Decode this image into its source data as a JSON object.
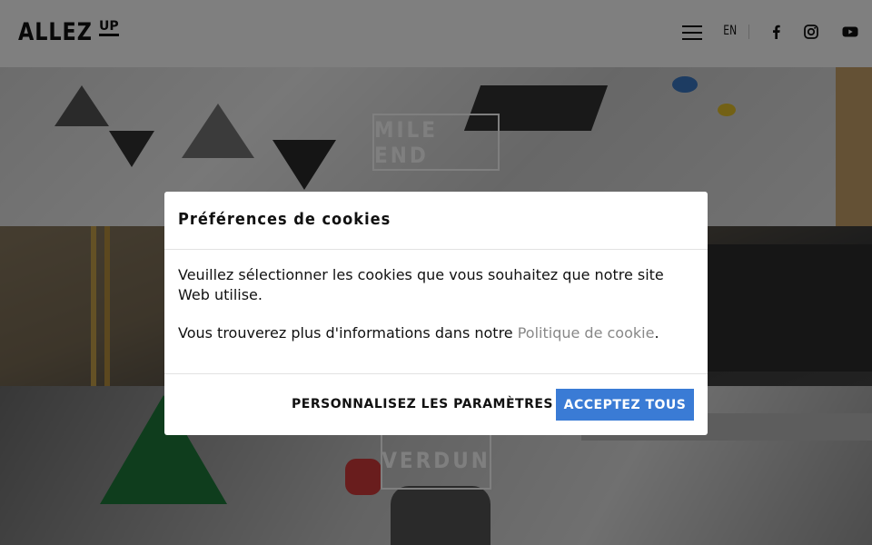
{
  "header": {
    "logo_main": "ALLEZ",
    "logo_sup": "UP",
    "lang": "EN",
    "icons": [
      "menu-icon",
      "facebook-icon",
      "instagram-icon",
      "youtube-icon"
    ]
  },
  "locations": [
    {
      "label": "MILE END"
    },
    {
      "label": ""
    },
    {
      "label": "VERDUN"
    }
  ],
  "cookie_modal": {
    "title": "Préférences de cookies",
    "text1": "Veuillez sélectionner les cookies que vous souhaitez que notre site Web utilise.",
    "text2_prefix": "Vous trouverez plus d'informations dans notre ",
    "policy_link": "Politique de cookie",
    "text2_suffix": ".",
    "customize_label": "PERSONNALISEZ LES PARAMÈTRES",
    "accept_label": "ACCEPTEZ TOUS"
  },
  "colors": {
    "accent": "#3a7bd5",
    "link": "#888888",
    "overlay": "rgba(0,0,0,0.5)"
  }
}
